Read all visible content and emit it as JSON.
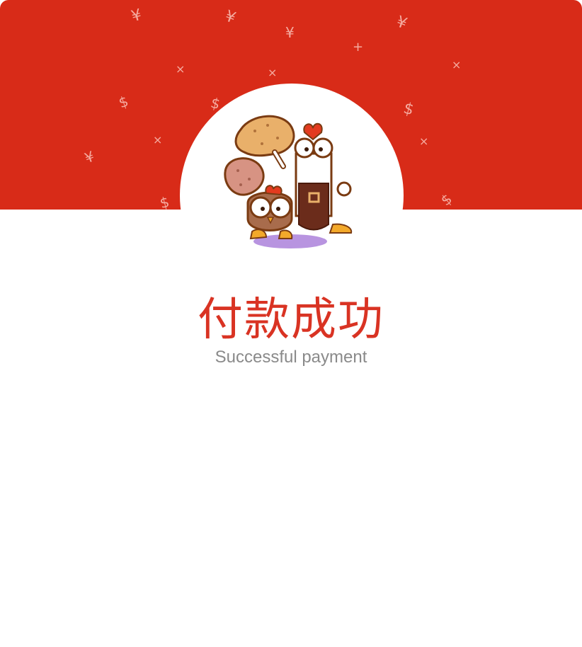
{
  "colors": {
    "banner": "#d82b18",
    "title": "#d93323",
    "subtitle": "#8a8a8a",
    "background": "#ffffff"
  },
  "header": {
    "decoration_icons": [
      "yen-icon",
      "dollar-icon",
      "cross-icon",
      "plus-icon"
    ]
  },
  "illustration": {
    "icon": "chicken-mascot-illustration"
  },
  "result": {
    "title": "付款成功",
    "subtitle": "Successful payment"
  }
}
